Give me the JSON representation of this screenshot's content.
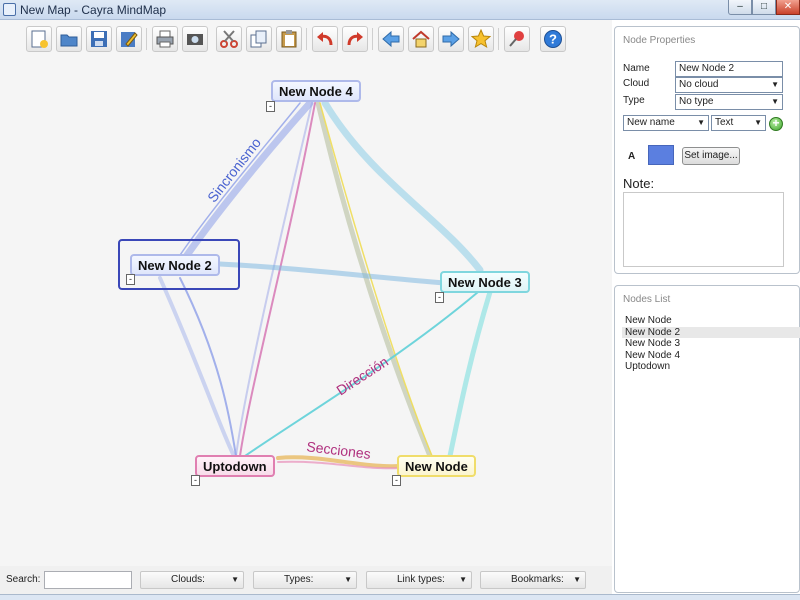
{
  "window": {
    "title": "New Map - Cayra MindMap",
    "min": "–",
    "max": "□",
    "close": "✕"
  },
  "toolbar": {
    "buttons": [
      {
        "name": "new-map-icon"
      },
      {
        "name": "open-folder-icon"
      },
      {
        "name": "save-disk-icon"
      },
      {
        "name": "edit-pencil-icon"
      },
      {
        "name": "print-icon"
      },
      {
        "name": "screenshot-camera-icon"
      },
      {
        "name": "cut-scissors-icon"
      },
      {
        "name": "copy-icon"
      },
      {
        "name": "paste-clipboard-icon"
      },
      {
        "name": "undo-arrow-icon"
      },
      {
        "name": "redo-arrow-icon"
      },
      {
        "name": "back-arrow-icon"
      },
      {
        "name": "home-icon"
      },
      {
        "name": "forward-arrow-icon"
      },
      {
        "name": "star-icon"
      },
      {
        "name": "pin-icon"
      },
      {
        "name": "help-icon"
      }
    ]
  },
  "map": {
    "nodes": {
      "node4": "New Node 4",
      "node2": "New Node 2",
      "node3": "New Node 3",
      "uptodown": "Uptodown",
      "node1": "New Node"
    },
    "link_labels": {
      "sincronismo": "Sincronismo",
      "direccion": "Dirección",
      "secciones": "Secciones"
    },
    "collapse_symbol": "-",
    "colors": {
      "blue": "#7f93e6",
      "cyan": "#5fd0d8",
      "yellow": "#f2de4e",
      "pink": "#d45aa0",
      "selection": "#3a47b8"
    }
  },
  "bottombar": {
    "search_label": "Search:",
    "search_value": "",
    "clouds": "Clouds:",
    "types": "Types:",
    "link_types": "Link types:",
    "bookmarks": "Bookmarks:"
  },
  "properties": {
    "header": "Node Properties",
    "name_label": "Name",
    "name_value": "New Node 2",
    "cloud_label": "Cloud",
    "cloud_value": "No cloud",
    "type_label": "Type",
    "type_value": "No type",
    "attr_name": "New name",
    "attr_type": "Text",
    "font_label": "A",
    "color_swatch": "#5b7fe0",
    "set_image": "Set image...",
    "note_label": "Note:",
    "note_value": ""
  },
  "nodes_list": {
    "header": "Nodes List",
    "items": [
      "New Node",
      "New Node 2",
      "New Node 3",
      "New Node 4",
      "Uptodown"
    ],
    "selected": "New Node 2"
  }
}
